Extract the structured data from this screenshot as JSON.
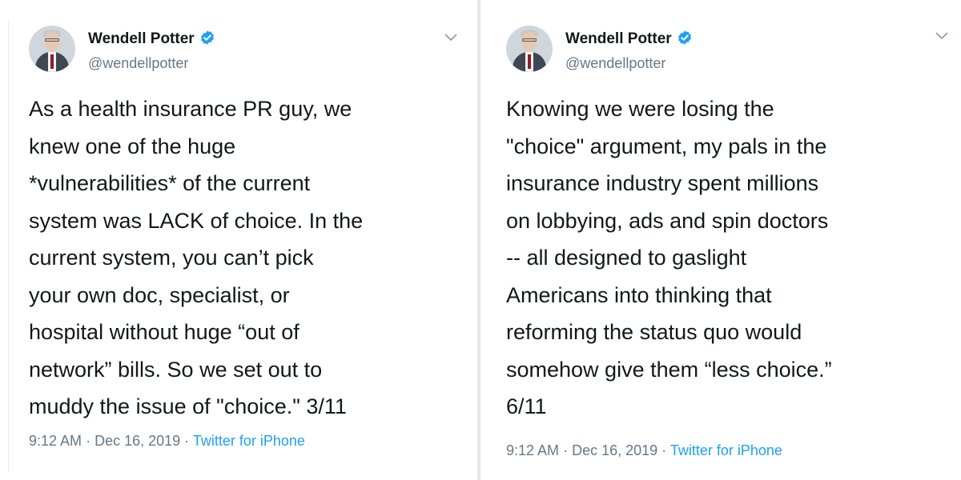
{
  "tweets": [
    {
      "author_name": "Wendell Potter",
      "handle": "@wendellpotter",
      "text_lines": [
        "As a health insurance PR guy, we",
        "knew one of the huge",
        "*vulnerabilities* of the current",
        "system was LACK of choice. In the",
        "current system, you can’t pick",
        "your own doc, specialist, or",
        "hospital without huge “out of",
        "network” bills. So we set out to",
        "muddy the issue of \"choice.\"  3/11"
      ],
      "time": "9:12 AM",
      "sep1": "·",
      "date": "Dec 16, 2019",
      "sep2": "·",
      "source": "Twitter for iPhone"
    },
    {
      "author_name": "Wendell Potter",
      "handle": "@wendellpotter",
      "text_lines": [
        "Knowing we were losing the",
        "\"choice\" argument, my pals in the",
        "insurance industry spent millions",
        "on lobbying, ads and spin doctors",
        "-- all designed to gaslight",
        "Americans into thinking that",
        "reforming the status quo would",
        "somehow give them “less choice.”",
        "6/11"
      ],
      "time": "9:12 AM",
      "sep1": "·",
      "date": "Dec 16, 2019",
      "sep2": "·",
      "source": "Twitter for iPhone"
    }
  ],
  "colors": {
    "text": "#14171a",
    "secondary": "#657786",
    "accent": "#1da1f2",
    "divider": "#e1e8ed"
  },
  "icons": {
    "verified": "verified-badge-icon",
    "caret": "chevron-down-icon"
  }
}
